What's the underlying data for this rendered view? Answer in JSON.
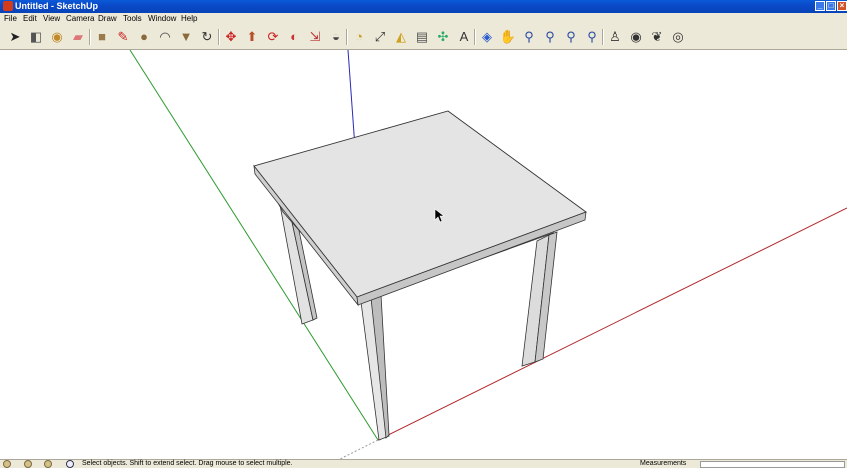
{
  "window": {
    "title": "Untitled - SketchUp"
  },
  "menu": [
    "File",
    "Edit",
    "View",
    "Camera",
    "Draw",
    "Tools",
    "Window",
    "Help"
  ],
  "toolbar": [
    {
      "name": "select-icon",
      "glyph": "➤",
      "color": "#222"
    },
    {
      "name": "make-component-icon",
      "glyph": "◧",
      "color": "#555"
    },
    {
      "name": "paint-bucket-icon",
      "glyph": "◉",
      "color": "#c08a2a"
    },
    {
      "name": "eraser-icon",
      "glyph": "▰",
      "color": "#d77"
    },
    {
      "name": "rectangle-icon",
      "glyph": "■",
      "color": "#9b7a4a"
    },
    {
      "name": "line-icon",
      "glyph": "✎",
      "color": "#c22"
    },
    {
      "name": "circle-icon",
      "glyph": "●",
      "color": "#8a6a3a"
    },
    {
      "name": "arc-icon",
      "glyph": "◠",
      "color": "#444"
    },
    {
      "name": "polygon-icon",
      "glyph": "▼",
      "color": "#8a6a3a"
    },
    {
      "name": "freehand-icon",
      "glyph": "↻",
      "color": "#333"
    },
    {
      "name": "move-icon",
      "glyph": "✥",
      "color": "#c22"
    },
    {
      "name": "push-pull-icon",
      "glyph": "⬆",
      "color": "#b5502a"
    },
    {
      "name": "rotate-icon",
      "glyph": "⟳",
      "color": "#c22"
    },
    {
      "name": "follow-me-icon",
      "glyph": "◐",
      "color": "#c33"
    },
    {
      "name": "scale-icon",
      "glyph": "⇲",
      "color": "#b33"
    },
    {
      "name": "offset-icon",
      "glyph": "◒",
      "color": "#444"
    },
    {
      "name": "tape-measure-icon",
      "glyph": "◔",
      "color": "#c89a20"
    },
    {
      "name": "dimension-icon",
      "glyph": "⤢",
      "color": "#333"
    },
    {
      "name": "protractor-icon",
      "glyph": "◭",
      "color": "#d0a020"
    },
    {
      "name": "text-icon",
      "glyph": "▤",
      "color": "#555"
    },
    {
      "name": "axes-icon",
      "glyph": "✣",
      "color": "#2a6"
    },
    {
      "name": "3d-text-icon",
      "glyph": "A",
      "color": "#333"
    },
    {
      "name": "orbit-icon",
      "glyph": "◈",
      "color": "#2a5ad0"
    },
    {
      "name": "pan-icon",
      "glyph": "✋",
      "color": "#555"
    },
    {
      "name": "zoom-icon",
      "glyph": "⚲",
      "color": "#2a4aa0"
    },
    {
      "name": "zoom-window-icon",
      "glyph": "⚲",
      "color": "#2a4aa0"
    },
    {
      "name": "zoom-extents-icon",
      "glyph": "⚲",
      "color": "#2a4aa0"
    },
    {
      "name": "previous-view-icon",
      "glyph": "⚲",
      "color": "#2a4aa0"
    },
    {
      "name": "position-camera-icon",
      "glyph": "♙",
      "color": "#333"
    },
    {
      "name": "look-around-icon",
      "glyph": "◉",
      "color": "#333"
    },
    {
      "name": "walk-icon",
      "glyph": "❦",
      "color": "#333"
    },
    {
      "name": "section-plane-icon",
      "glyph": "◎",
      "color": "#333"
    }
  ],
  "status": {
    "hint": "Select objects. Shift to extend select. Drag mouse to select multiple.",
    "measurements_label": "Measurements"
  },
  "colors": {
    "axis_red": "#b3272b",
    "axis_green": "#2e9a2e",
    "axis_blue": "#2a2ab8",
    "table_top": "#e4e4e4"
  }
}
